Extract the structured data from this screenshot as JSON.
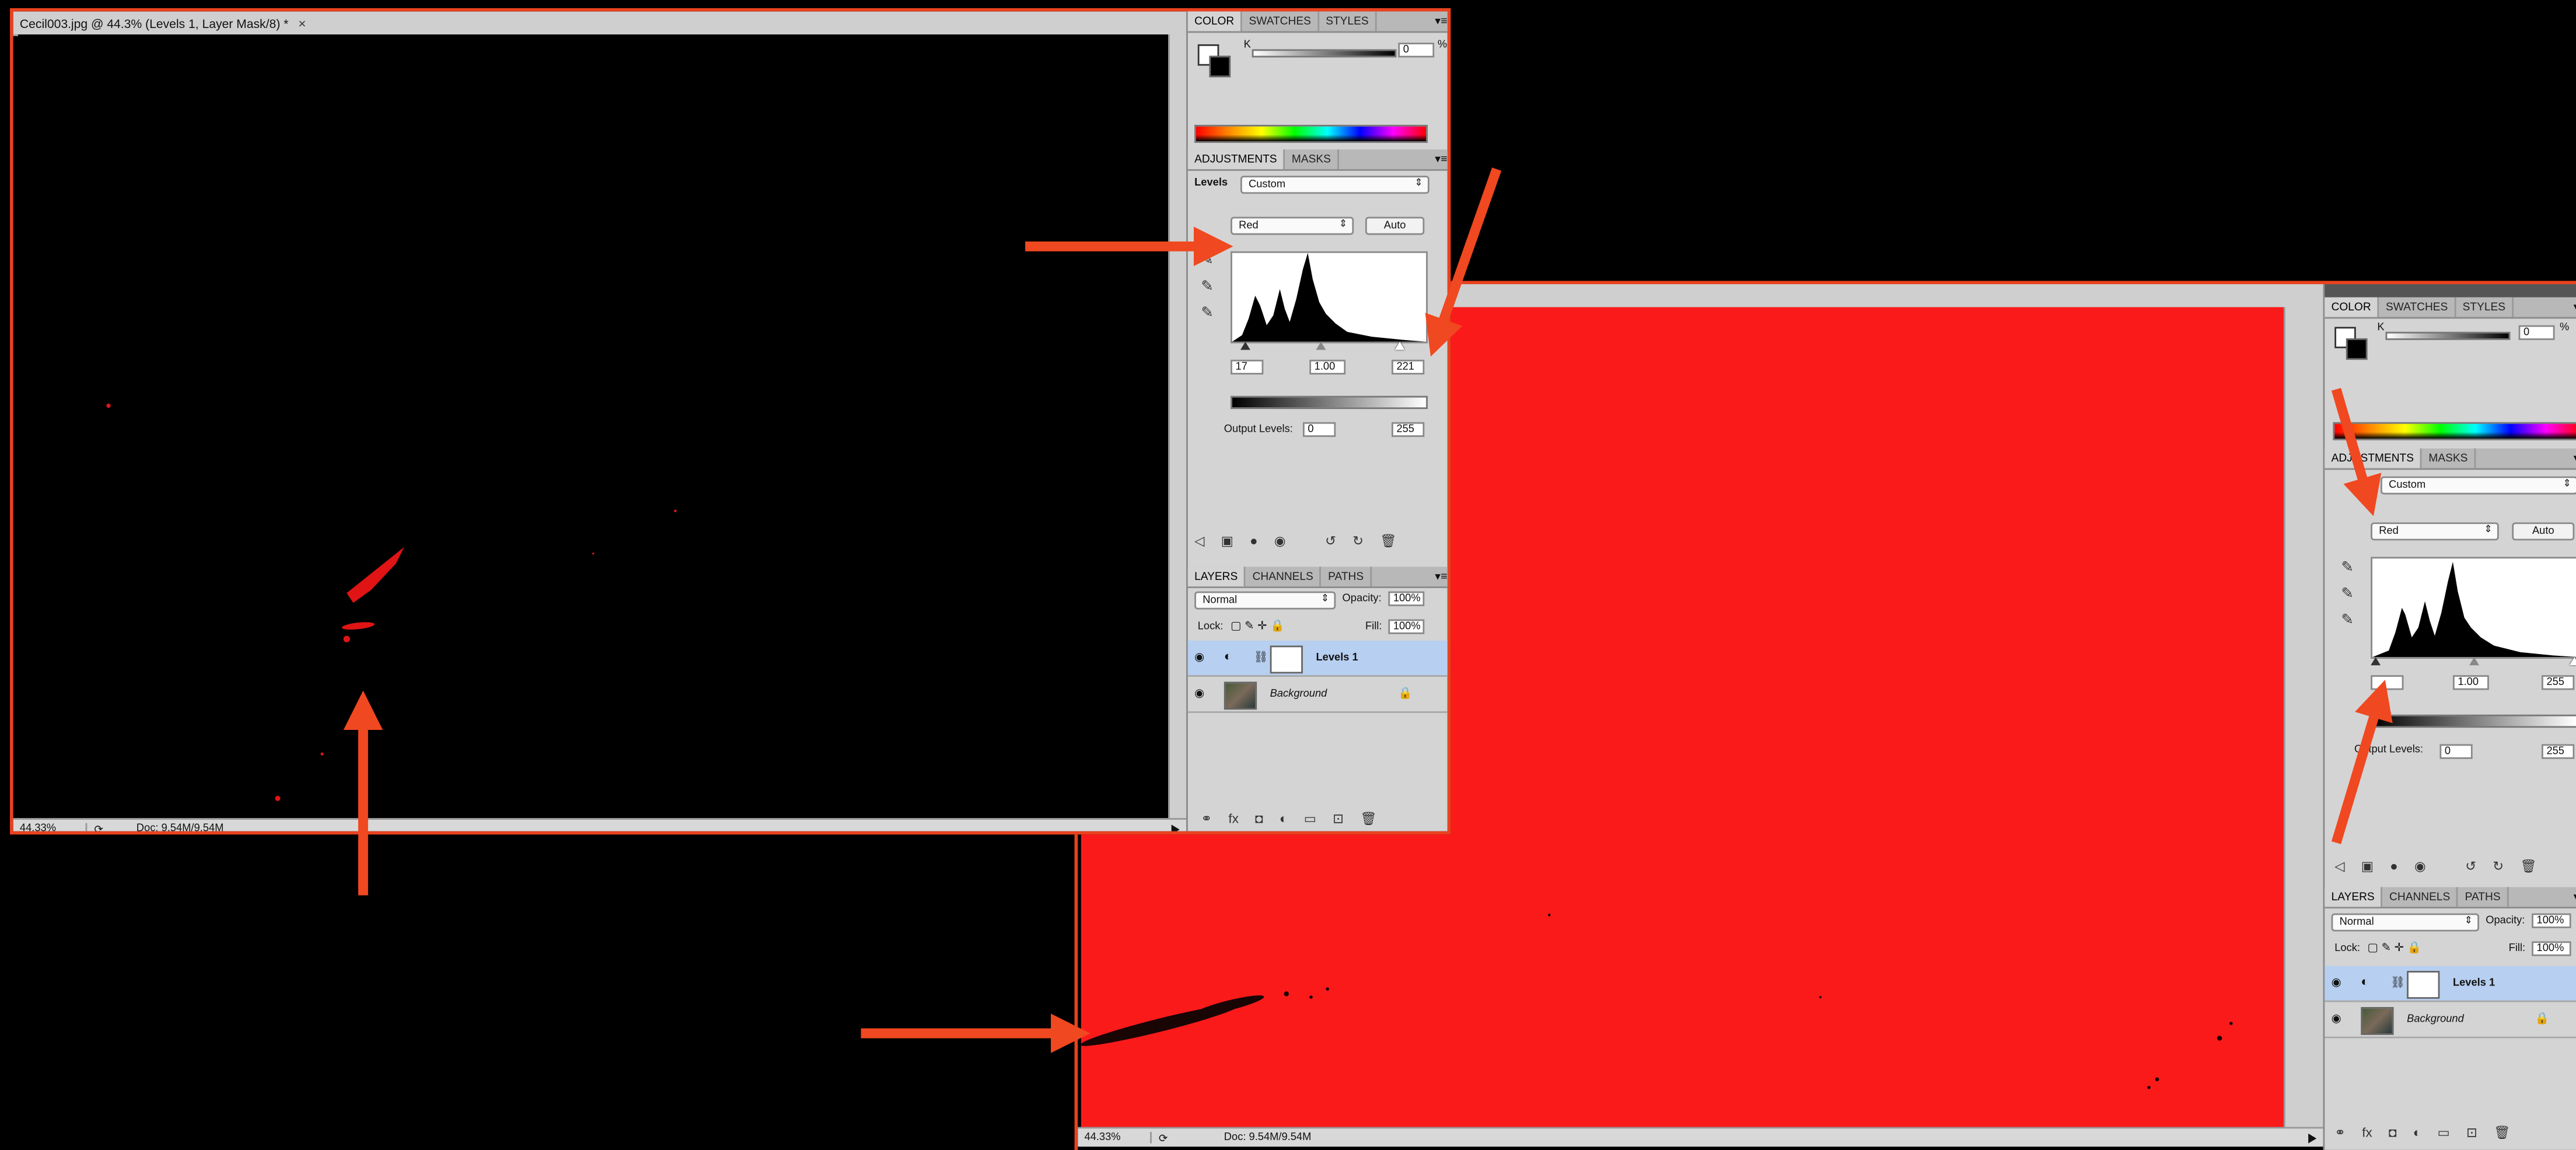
{
  "document": {
    "tab_title": "Cecil003.jpg @ 44.3% (Levels 1, Layer Mask/8) *",
    "close_glyph": "×",
    "zoom": "44.33%",
    "doc_size": "Doc: 9.54M/9.54M"
  },
  "color_panel": {
    "tabs": [
      "COLOR",
      "SWATCHES",
      "STYLES"
    ],
    "channel_label": "K",
    "value": "0",
    "unit": "%"
  },
  "adjustments_panel": {
    "tabs": [
      "ADJUSTMENTS",
      "MASKS"
    ],
    "type_label": "Levels",
    "preset": "Custom",
    "channel": "Red",
    "auto_label": "Auto",
    "left": {
      "input_black": "17",
      "input_gamma": "1.00",
      "input_white": "221"
    },
    "right": {
      "input_black": "",
      "input_gamma": "1.00",
      "input_white": "255"
    },
    "output_label": "Output Levels:",
    "output_black": "0",
    "output_white": "255"
  },
  "layers_panel": {
    "tabs": [
      "LAYERS",
      "CHANNELS",
      "PATHS"
    ],
    "blend_mode": "Normal",
    "opacity_label": "Opacity:",
    "opacity": "100%",
    "lock_label": "Lock:",
    "fill_label": "Fill:",
    "fill": "100%",
    "layers": [
      {
        "name": "Levels 1",
        "selected": true
      },
      {
        "name": "Background",
        "selected": false
      }
    ]
  },
  "colors": {
    "accent_border": "#e9421f",
    "arrow": "#f04820",
    "canvas_red": "#fb1a1a",
    "selection": "#b7cff0"
  }
}
